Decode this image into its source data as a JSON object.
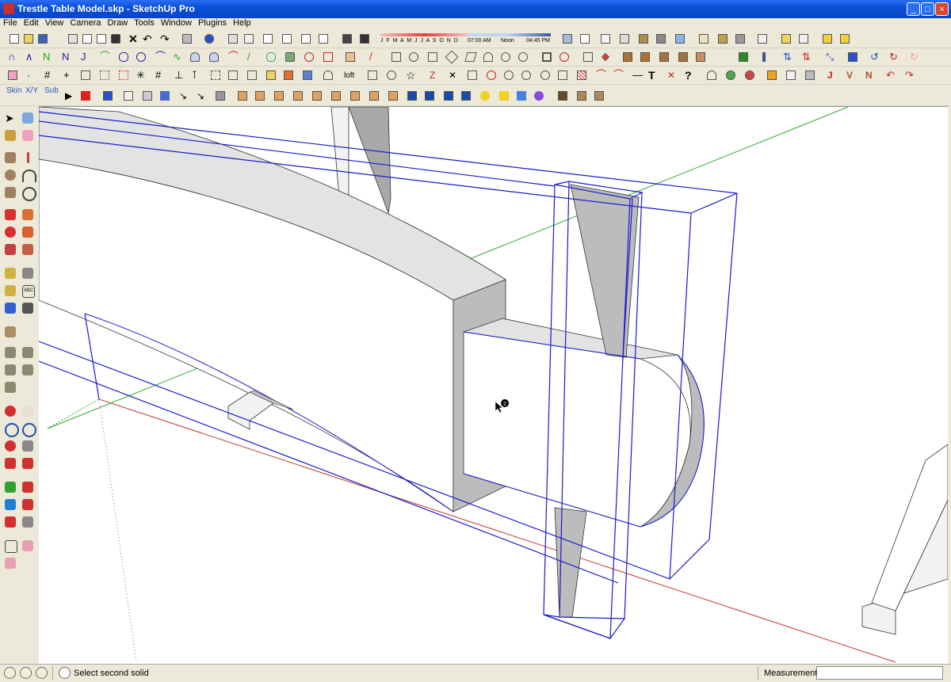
{
  "window": {
    "title": "Trestle Table Model.skp - SketchUp Pro",
    "controls": [
      "_",
      "□",
      "×"
    ]
  },
  "menu": [
    "File",
    "Edit",
    "View",
    "Camera",
    "Draw",
    "Tools",
    "Window",
    "Plugins",
    "Help"
  ],
  "toolbar": {
    "shadow_months": "J F M A M J J A S O N D",
    "time_start": "07:00 AM",
    "time_noon": "Noon",
    "time_end": "04:45 PM",
    "loft_label": "loft",
    "skin_label": "Skin",
    "xy_label": "X/Y",
    "sub_label": "Sub",
    "abc_label": "ABC"
  },
  "viewport": {
    "cursor_badge": "2"
  },
  "status": {
    "hint": "Select second solid",
    "measurements_label": "Measurements",
    "measurements_value": ""
  },
  "colors": {
    "selection": "#1a1ad0",
    "red_axis": "#c0392b",
    "green_axis": "#2ea82e",
    "face_gray": "#c8c8c8",
    "title_blue": "#0a4fd8"
  }
}
